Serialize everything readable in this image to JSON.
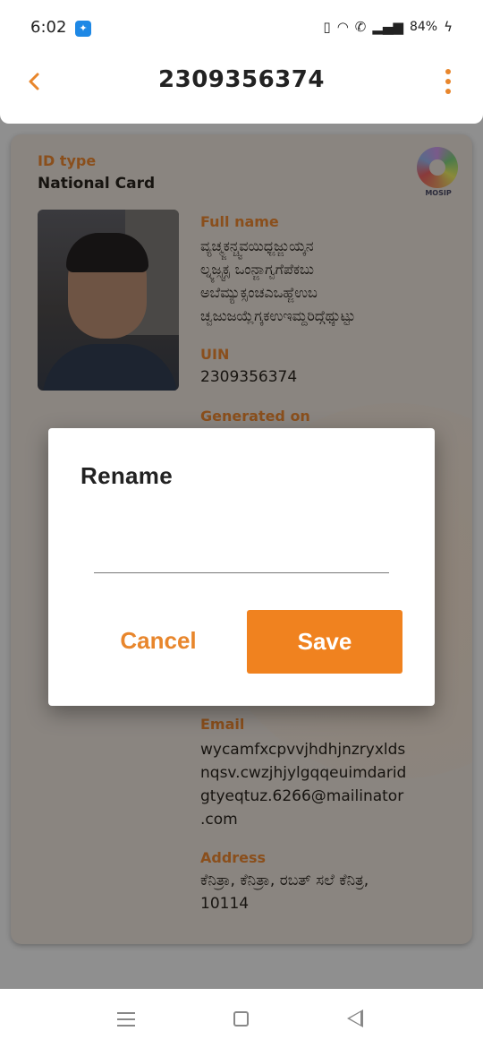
{
  "status_bar": {
    "time": "6:02",
    "app_icon": "app-notification-icon",
    "icons": [
      "vibrate-icon",
      "wifi-icon",
      "wifi-calling-icon",
      "signal-icon"
    ],
    "battery": "84%",
    "charging_icon": "lightning-icon"
  },
  "app_bar": {
    "back_icon": "chevron-left-icon",
    "title": "2309356374",
    "menu_icon": "more-vertical-icon",
    "accent_color": "#e8862c"
  },
  "card": {
    "id_type_label": "ID type",
    "id_type_value": "National Card",
    "logo_text": "MOSIP",
    "full_name_label": "Full name",
    "full_name_lines": [
      "ವ್ಯಚ್ಮ್ಜಕನ್ಚ್ವವಯಿಧ್ಜಜ್ಜುಯ್ಕನ",
      "ಲ್ನ್ಯಜ್ಸ್ವಕ್ಸ ಒಂನ್ಜಾಗ್ವಗೆಪೆಕಬು",
      "ಅಬೆಮ್ಯುಕ್ಸಂಚಎಒಹ್ಜೆಉಬ",
      "ಚ್ವಜುಜಯ್ಲೆಗ್ಕಕಉಇಮ್ದರಿದ್ಗೆಥ್ಕುಟ್ಟು"
    ],
    "uin_label": "UIN",
    "uin_value": "2309356374",
    "generated_on_label": "Generated on",
    "email_label": "Email",
    "email_lines": [
      "wycamfxcpvvjhdhjnzryxlds",
      "nqsv.cwzjhjylgqqeuimdarid",
      "gtyeqtuz.6266@mailinator",
      ".com"
    ],
    "address_label": "Address",
    "address_lines": [
      "ಕೆನಿತ್ರಾ, ಕೆನಿತ್ರಾ, ರಬತ್ ಸಲೆ ಕೆನಿತ್ರ,",
      "10114"
    ]
  },
  "dialog": {
    "title": "Rename",
    "input_value": "",
    "input_placeholder": "",
    "cancel_label": "Cancel",
    "save_label": "Save",
    "save_color": "#f0821f"
  },
  "nav_bar": {
    "icons": [
      "recents-icon",
      "home-icon",
      "back-triangle-icon"
    ]
  }
}
